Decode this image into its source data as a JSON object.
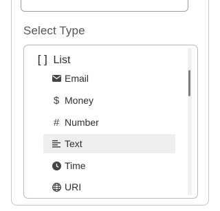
{
  "section_label": "Select Type",
  "list": {
    "group_label": "List",
    "group_icon": "brackets-icon",
    "items": [
      {
        "label": "Email",
        "icon": "envelope-icon",
        "selected": false
      },
      {
        "label": "Money",
        "icon": "dollar-icon",
        "selected": false
      },
      {
        "label": "Number",
        "icon": "hash-icon",
        "selected": false
      },
      {
        "label": "Text",
        "icon": "text-lines-icon",
        "selected": true
      },
      {
        "label": "Time",
        "icon": "clock-icon",
        "selected": false
      },
      {
        "label": "URI",
        "icon": "globe-icon",
        "selected": false
      }
    ]
  },
  "colors": {
    "selected_bg": "#eeeeee",
    "border": "#b9b9b9"
  }
}
